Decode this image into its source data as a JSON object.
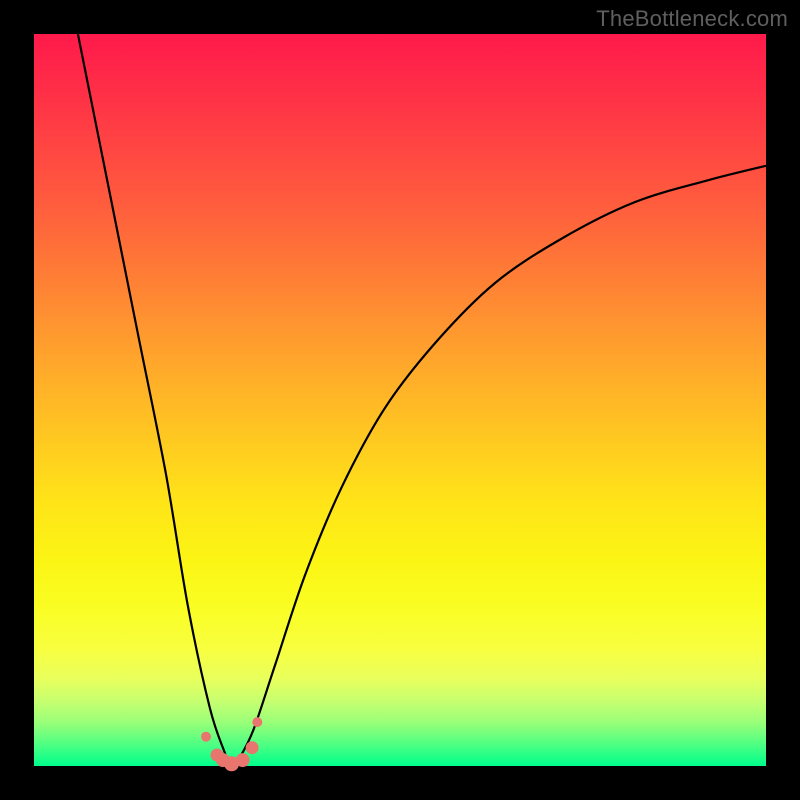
{
  "watermark": "TheBottleneck.com",
  "colors": {
    "frame": "#000000",
    "curve": "#000000",
    "dots": "#e8766e",
    "gradient_top": "#ff1a4b",
    "gradient_bottom": "#00ff8c"
  },
  "chart_data": {
    "type": "line",
    "title": "",
    "xlabel": "",
    "ylabel": "",
    "xlim": [
      0,
      100
    ],
    "ylim": [
      0,
      100
    ],
    "note": "V-shaped bottleneck curve with minimum near x≈27. Values estimated from pixels; original has no axis ticks.",
    "series": [
      {
        "name": "bottleneck-curve",
        "x": [
          6,
          10,
          14,
          18,
          21,
          24,
          26,
          27,
          28,
          30,
          33,
          37,
          42,
          48,
          55,
          63,
          72,
          82,
          92,
          100
        ],
        "y": [
          100,
          80,
          60,
          40,
          22,
          8,
          2,
          0,
          1,
          5,
          14,
          26,
          38,
          49,
          58,
          66,
          72,
          77,
          80,
          82
        ]
      }
    ],
    "highlight_dots": {
      "name": "near-minimum-points",
      "x": [
        23.5,
        25.0,
        25.8,
        27.0,
        28.5,
        29.8,
        30.5
      ],
      "y": [
        4.0,
        1.5,
        0.8,
        0.3,
        0.8,
        2.5,
        6.0
      ]
    }
  }
}
